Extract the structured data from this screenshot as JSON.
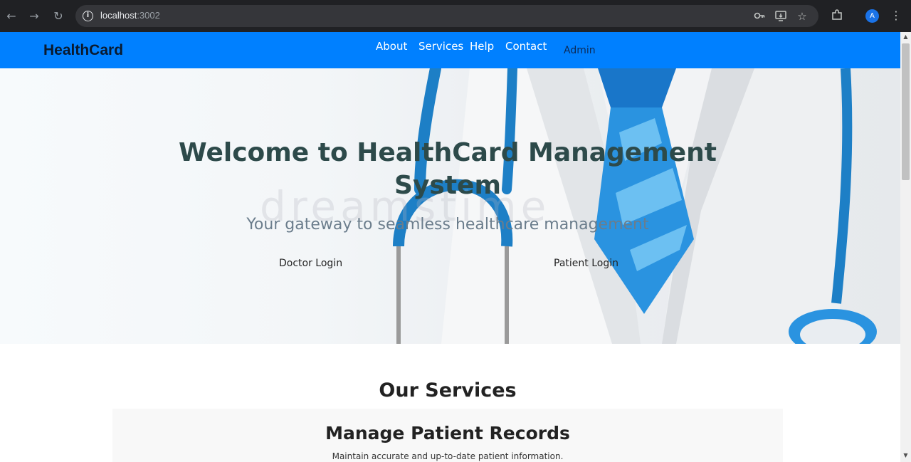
{
  "browser": {
    "url_host": "localhost",
    "url_port": ":3002",
    "profile_initial": "A",
    "icons": [
      "back-icon",
      "forward-icon",
      "reload-icon",
      "info-icon",
      "key-icon",
      "install-icon",
      "star-icon",
      "extensions-icon",
      "kebab-menu-icon"
    ]
  },
  "navbar": {
    "brand": "HealthCard",
    "links": [
      "About",
      "Services",
      "Help",
      "Contact"
    ],
    "admin": "Admin",
    "background": "#0080ff"
  },
  "hero": {
    "title": "Welcome to HealthCard Management System",
    "subtitle": "Your gateway to seamless healthcare management",
    "watermark": "dreamstime",
    "doctor_login": "Doctor Login",
    "patient_login": "Patient Login"
  },
  "services": {
    "heading": "Our Services",
    "cards": [
      {
        "title": "Manage Patient Records",
        "description": "Maintain accurate and up-to-date patient information."
      }
    ]
  }
}
